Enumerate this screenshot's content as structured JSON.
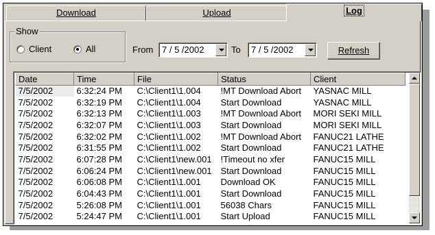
{
  "tabs": [
    {
      "label": "Download"
    },
    {
      "label": "Upload"
    },
    {
      "label": "Log"
    }
  ],
  "show": {
    "title": "Show",
    "options": [
      {
        "label": "Client",
        "selected": false
      },
      {
        "label": "All",
        "selected": true
      }
    ]
  },
  "date_range": {
    "from_label": "From",
    "from_value": "7 / 5 /2002",
    "to_label": "To",
    "to_value": "7 / 5 /2002"
  },
  "refresh_label": "Refresh",
  "log": {
    "columns": [
      "Date",
      "Time",
      "File",
      "Status",
      "Client"
    ],
    "rows": [
      {
        "date": "7/5/2002",
        "time": "6:32:24 PM",
        "file": "C:\\Client1\\1.004",
        "status": "!MT Download Abort",
        "client": "YASNAC MILL"
      },
      {
        "date": "7/5/2002",
        "time": "6:32:19 PM",
        "file": "C:\\Client1\\1.004",
        "status": "Start Download",
        "client": "YASNAC MILL"
      },
      {
        "date": "7/5/2002",
        "time": "6:32:13 PM",
        "file": "C:\\Client1\\1.003",
        "status": "!MT Download Abort",
        "client": "MORI SEKI MILL"
      },
      {
        "date": "7/5/2002",
        "time": "6:32:07 PM",
        "file": "C:\\Client1\\1.003",
        "status": "Start Download",
        "client": "MORI SEKI MILL"
      },
      {
        "date": "7/5/2002",
        "time": "6:32:02 PM",
        "file": "C:\\Client1\\1.002",
        "status": "!MT Download Abort",
        "client": "FANUC21 LATHE"
      },
      {
        "date": "7/5/2002",
        "time": "6:31:55 PM",
        "file": "C:\\Client1\\1.002",
        "status": "Start Download",
        "client": "FANUC21 LATHE"
      },
      {
        "date": "7/5/2002",
        "time": "6:07:28 PM",
        "file": "C:\\Client1\\new.001",
        "status": "!Timeout no xfer",
        "client": "FANUC15 MILL"
      },
      {
        "date": "7/5/2002",
        "time": "6:06:24 PM",
        "file": "C:\\Client1\\new.001",
        "status": "Start Download",
        "client": "FANUC15 MILL"
      },
      {
        "date": "7/5/2002",
        "time": "6:06:08 PM",
        "file": "C:\\Client1\\1.001",
        "status": "Download OK",
        "client": "FANUC15 MILL"
      },
      {
        "date": "7/5/2002",
        "time": "6:04:43 PM",
        "file": "C:\\Client1\\1.001",
        "status": "Start Download",
        "client": "FANUC15 MILL"
      },
      {
        "date": "7/5/2002",
        "time": "5:26:08 PM",
        "file": "C:\\Client1\\1.001",
        "status": "56038 Chars",
        "client": "FANUC15 MILL"
      },
      {
        "date": "7/5/2002",
        "time": "5:24:47 PM",
        "file": "C:\\Client1\\1.001",
        "status": "Start Upload",
        "client": "FANUC15 MILL"
      }
    ]
  }
}
